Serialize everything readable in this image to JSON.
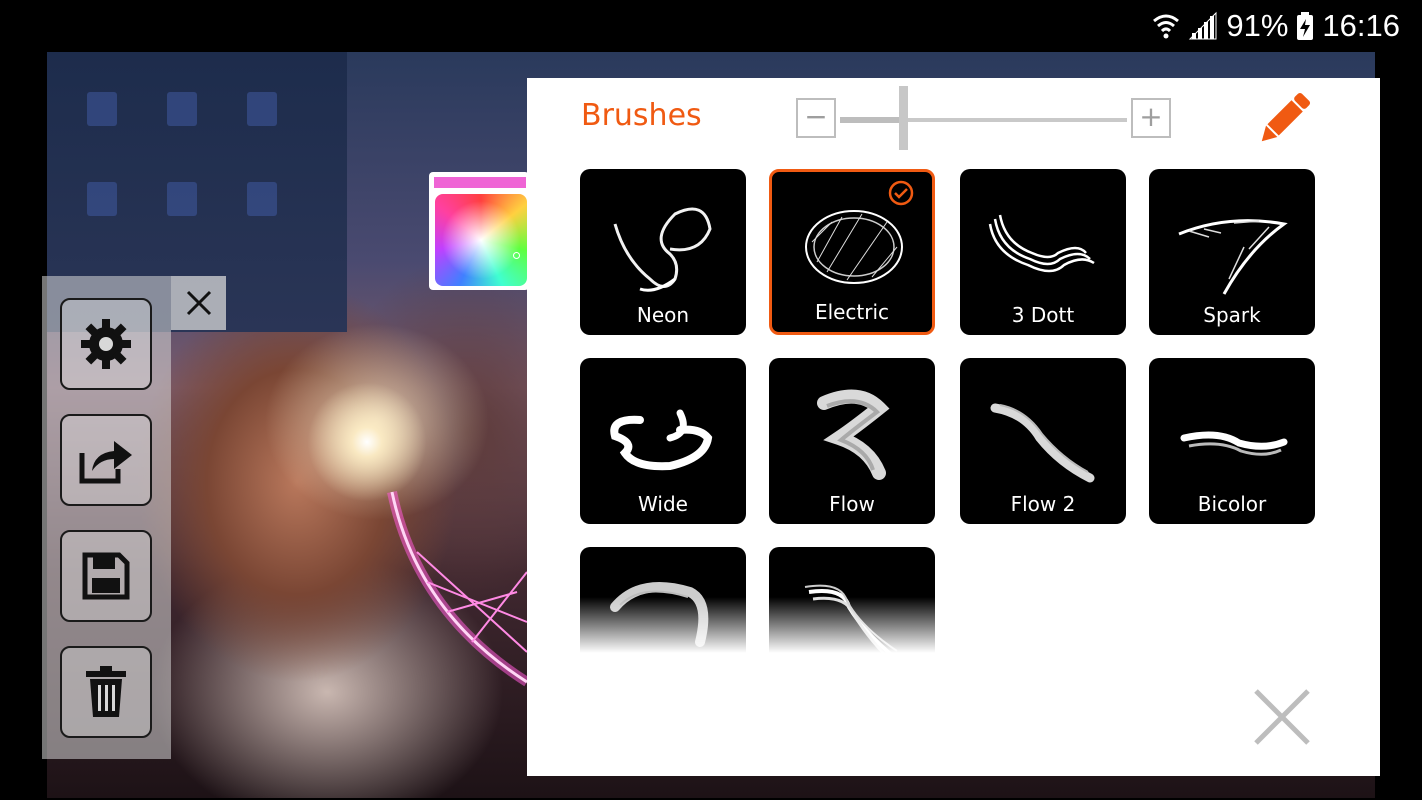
{
  "status_bar": {
    "battery": "91%",
    "time": "16:16"
  },
  "brushes_panel": {
    "title": "Brushes",
    "size_minus": "−",
    "size_plus": "+",
    "brush_size_fraction": 0.22,
    "selected_brush": "Electric",
    "brushes": [
      {
        "label": "Neon"
      },
      {
        "label": "Electric"
      },
      {
        "label": "3 Dott"
      },
      {
        "label": "Spark"
      },
      {
        "label": "Wide"
      },
      {
        "label": "Flow"
      },
      {
        "label": "Flow 2"
      },
      {
        "label": "Bicolor"
      },
      {
        "label": ""
      },
      {
        "label": ""
      }
    ]
  },
  "color_picker": {
    "current_color": "#ef64d5"
  },
  "toolbar": {
    "icons": [
      "gear-icon",
      "share-icon",
      "save-icon",
      "trash-icon",
      "close-icon"
    ]
  },
  "colors": {
    "accent": "#f05a12",
    "neon_stroke": "#ff5ad8"
  }
}
